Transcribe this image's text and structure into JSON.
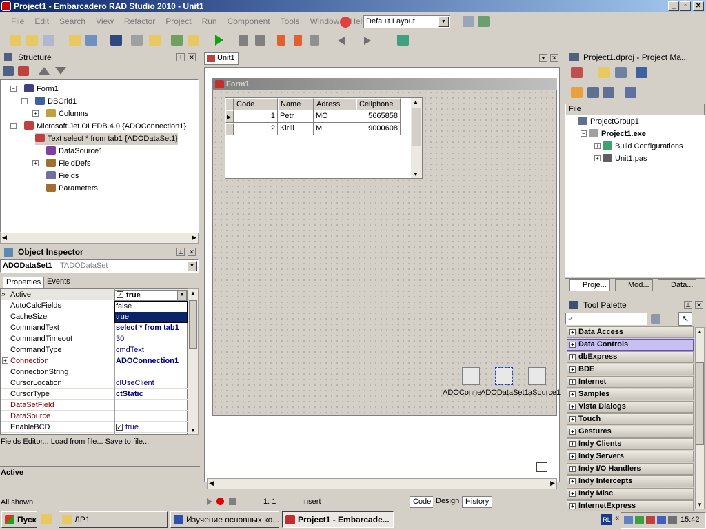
{
  "window": {
    "title": "Project1 - Embarcadero RAD Studio 2010 - Unit1"
  },
  "menu": [
    "File",
    "Edit",
    "Search",
    "View",
    "Refactor",
    "Project",
    "Run",
    "Component",
    "Tools",
    "Window",
    "Help"
  ],
  "layout_combo": "Default Layout",
  "structure": {
    "title": "Structure",
    "items": [
      {
        "label": "Form1"
      },
      {
        "label": "DBGrid1"
      },
      {
        "label": "Columns"
      },
      {
        "label": "Microsoft.Jet.OLEDB.4.0 {ADOConnection1}"
      },
      {
        "label": "Text select * from tab1 {ADODataSet1}"
      },
      {
        "label": "DataSource1"
      },
      {
        "label": "FieldDefs"
      },
      {
        "label": "Fields"
      },
      {
        "label": "Parameters"
      }
    ]
  },
  "inspector": {
    "title": "Object Inspector",
    "object_name": "ADODataSet1",
    "object_type": "TADODataSet",
    "tabs": [
      "Properties",
      "Events"
    ],
    "rows": [
      {
        "name": "Active",
        "value": "true"
      },
      {
        "name": "AutoCalcFields",
        "value": ""
      },
      {
        "name": "CacheSize",
        "value": ""
      },
      {
        "name": "CommandText",
        "value": "select * from tab1"
      },
      {
        "name": "CommandTimeout",
        "value": "30"
      },
      {
        "name": "CommandType",
        "value": "cmdText"
      },
      {
        "name": "Connection",
        "value": "ADOConnection1"
      },
      {
        "name": "ConnectionString",
        "value": ""
      },
      {
        "name": "CursorLocation",
        "value": "clUseClient"
      },
      {
        "name": "CursorType",
        "value": "ctStatic"
      },
      {
        "name": "DataSetField",
        "value": ""
      },
      {
        "name": "DataSource",
        "value": ""
      },
      {
        "name": "EnableBCD",
        "value": "true"
      }
    ],
    "dropdown_options": [
      "false",
      "true"
    ],
    "actions": "Fields Editor...   Load from file...   Save to file...",
    "description": "Active",
    "status": "All shown"
  },
  "editor": {
    "tab": "Unit1",
    "form_title": "Form1",
    "grid": {
      "headers": [
        "Code",
        "Name",
        "Adress",
        "Cellphone"
      ],
      "rows": [
        [
          "1",
          "Petr",
          "MO",
          "5665858"
        ],
        [
          "2",
          "Kirill",
          "M",
          "9000608"
        ]
      ]
    },
    "components": [
      "ADOConne",
      "ADODataSet1",
      "aSource1"
    ],
    "status": {
      "position": "1:   1",
      "mode": "Insert"
    },
    "bottom_tabs": [
      "Code",
      "Design",
      "History"
    ]
  },
  "project_manager": {
    "title": "Project1.dproj - Project Ma...",
    "column": "File",
    "items": [
      {
        "label": "ProjectGroup1"
      },
      {
        "label": "Project1.exe"
      },
      {
        "label": "Build Configurations"
      },
      {
        "label": "Unit1.pas"
      }
    ],
    "tabs": [
      "Proje...",
      "Mod...",
      "Data..."
    ]
  },
  "tool_palette": {
    "title": "Tool Palette",
    "categories": [
      "Data Access",
      "Data Controls",
      "dbExpress",
      "BDE",
      "Internet",
      "Samples",
      "Vista Dialogs",
      "Touch",
      "Gestures",
      "Indy Clients",
      "Indy Servers",
      "Indy I/O Handlers",
      "Indy Intercepts",
      "Indy Misc",
      "InternetExpress"
    ]
  },
  "taskbar": {
    "start": "Пуск",
    "tasks": [
      "ЛР1",
      "Изучение основных ко...",
      "Project1 - Embarcade..."
    ],
    "lang": "RL",
    "time": "15:42"
  }
}
